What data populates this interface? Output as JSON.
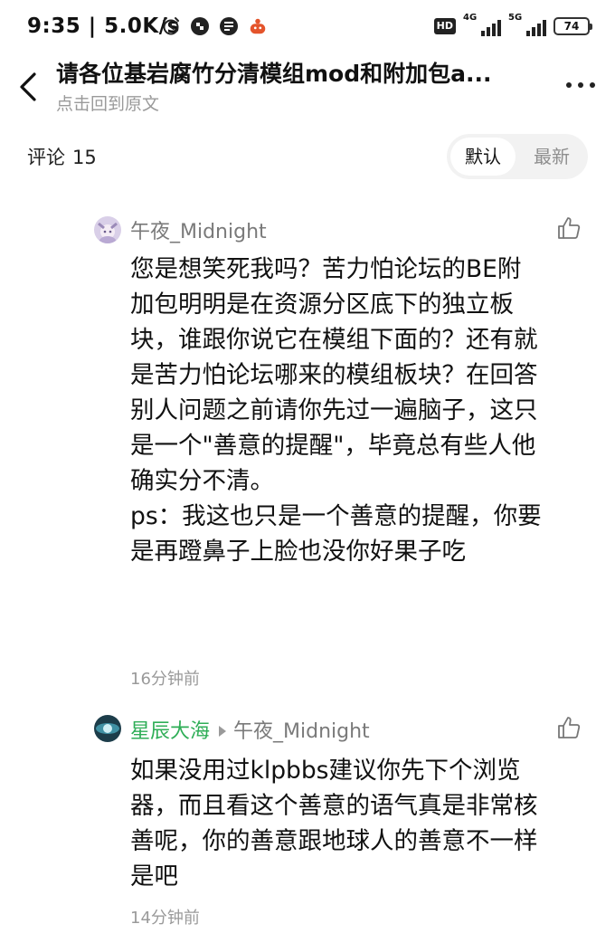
{
  "status_bar": {
    "time": "9:35",
    "speed": "5.0K/s",
    "hd_label": "HD",
    "net1": "4G",
    "net2": "5G",
    "battery": "74"
  },
  "header": {
    "title": "请各位基岩腐竹分清模组mod和附加包a...",
    "subtitle": "点击回到原文"
  },
  "comments_header": {
    "label": "评论",
    "count": "15",
    "sort_default": "默认",
    "sort_newest": "最新"
  },
  "comments": [
    {
      "author": "午夜_Midnight",
      "body": "您是想笑死我吗？苦力怕论坛的BE附加包明明是在资源分区底下的独立板块，谁跟你说它在模组下面的？还有就是苦力怕论坛哪来的模组板块？在回答别人问题之前请你先过一遍脑子，这只是一个\"善意的提醒\"，毕竟总有些人他确实分不清。\nps：我这也只是一个善意的提醒，你要是再蹬鼻子上脸也没你好果子吃",
      "time": "16分钟前"
    },
    {
      "author": "星辰大海",
      "reply_to": "午夜_Midnight",
      "body": "如果没用过klpbbs建议你先下个浏览器，而且看这个善意的语气真是非常核善呢，你的善意跟地球人的善意不一样是吧",
      "time": "14分钟前"
    }
  ],
  "colors": {
    "author_reply": "#2fae57",
    "meta_gray": "#9a9a9a"
  }
}
